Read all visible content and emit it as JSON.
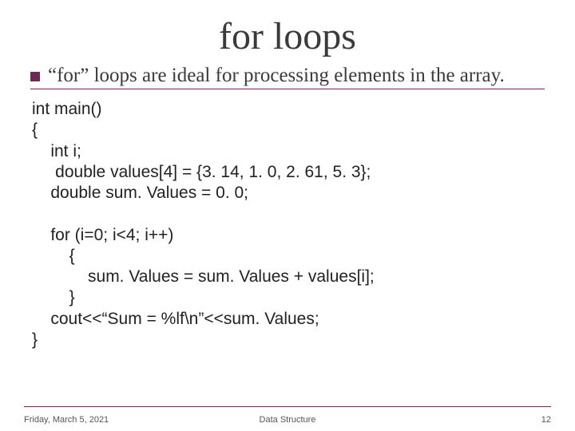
{
  "title": "for loops",
  "subtitle": "“for” loops are ideal for processing elements in the array.",
  "code": {
    "l1": "int main()",
    "l2": "{",
    "l3": "    int i;",
    "l4": "     double values[4] = {3. 14, 1. 0, 2. 61, 5. 3};",
    "l5": "    double sum. Values = 0. 0;",
    "blank": "",
    "l6": "    for (i=0; i<4; i++)",
    "l7": "        {",
    "l8": "            sum. Values = sum. Values + values[i];",
    "l9": "        }",
    "l10": "    cout<<“Sum = %lf\\n”<<sum. Values;",
    "l11": "}"
  },
  "footer": {
    "date": "Friday, March 5, 2021",
    "center": "Data Structure",
    "page": "12"
  }
}
